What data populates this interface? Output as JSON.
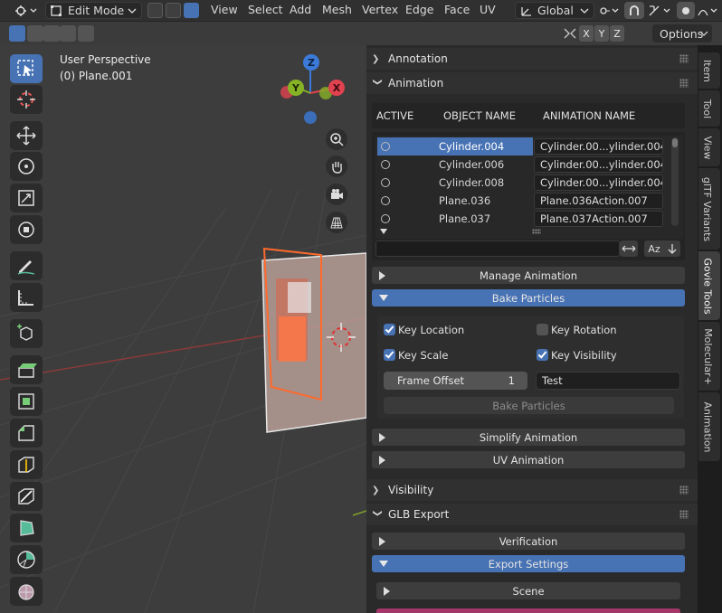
{
  "header": {
    "mode": "Edit Mode",
    "menus": [
      "View",
      "Select",
      "Add",
      "Mesh",
      "Vertex",
      "Edge",
      "Face",
      "UV"
    ],
    "orientation": "Global"
  },
  "toolrow": {
    "axes": [
      "X",
      "Y",
      "Z"
    ],
    "options_label": "Options"
  },
  "viewport": {
    "perspective_label": "User Perspective",
    "object_label": "(0) Plane.001",
    "gizmo": {
      "z": "Z",
      "y": "Y",
      "x": "X"
    }
  },
  "panel": {
    "annotation_title": "Annotation",
    "animation_title": "Animation",
    "columns": [
      "ACTIVE",
      "OBJECT NAME",
      "ANIMATION NAME"
    ],
    "rows": [
      {
        "object": "Cylinder.004",
        "animation": "Cylinder.00...ylinder.004",
        "selected": true
      },
      {
        "object": "Cylinder.006",
        "animation": "Cylinder.00...ylinder.004",
        "selected": false
      },
      {
        "object": "Cylinder.008",
        "animation": "Cylinder.00...ylinder.004",
        "selected": false
      },
      {
        "object": "Plane.036",
        "animation": "Plane.036Action.007",
        "selected": false
      },
      {
        "object": "Plane.037",
        "animation": "Plane.037Action.007",
        "selected": false
      }
    ],
    "sort_label": "Az",
    "manage_animation": "Manage Animation",
    "bake_particles_title": "Bake Particles",
    "key_location": "Key Location",
    "key_rotation": "Key Rotation",
    "key_scale": "Key Scale",
    "key_visibility": "Key Visibility",
    "frame_offset_label": "Frame Offset",
    "frame_offset_value": "1",
    "name_field": "Test",
    "bake_button": "Bake Particles",
    "simplify_animation": "Simplify Animation",
    "uv_animation": "UV Animation",
    "visibility_title": "Visibility",
    "glb_export_title": "GLB Export",
    "verification": "Verification",
    "export_settings": "Export Settings",
    "scene": "Scene"
  },
  "sidebar_tabs": [
    "Item",
    "Tool",
    "View",
    "glTF Variants",
    "Govie Tools",
    "Molecular+",
    "Animation"
  ],
  "colors": {
    "accent": "#4772b3",
    "panel_bg": "#2a2a2a",
    "viewport_bg": "#3d3d3d",
    "x_axis": "#e0424f",
    "y_axis": "#86b226",
    "z_axis": "#3b7ad8"
  }
}
